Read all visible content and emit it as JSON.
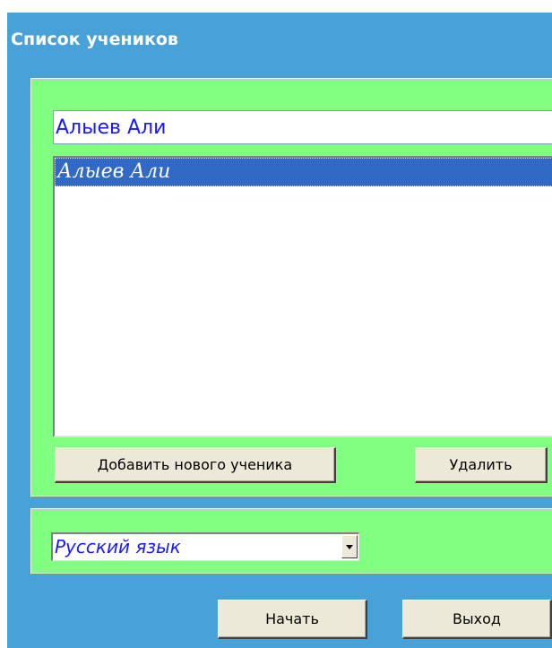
{
  "window": {
    "title": "Список учеников"
  },
  "students": {
    "name_input_value": "Алыев Али",
    "list_items": [
      "Алыев Али"
    ],
    "selected_index": 0,
    "add_button_label": "Добавить нового ученика",
    "delete_button_label": "Удалить"
  },
  "language": {
    "selected": "Русский язык"
  },
  "footer": {
    "start_button_label": "Начать",
    "exit_button_label": "Выход"
  },
  "colors": {
    "window_background": "#49a2d7",
    "group_background": "#80ff80",
    "selection": "#316ac5",
    "text_blue": "#1a1aff"
  }
}
